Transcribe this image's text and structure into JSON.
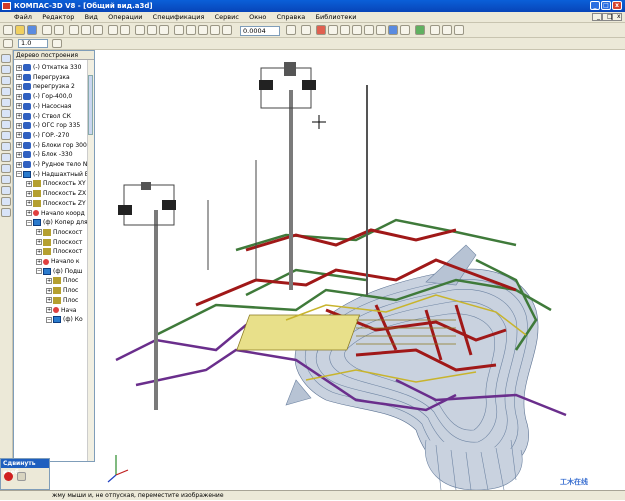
{
  "window": {
    "title": "КОМПАС-3D V8 - [Общий вид.a3d]",
    "controls": [
      "_",
      "□",
      "x"
    ]
  },
  "menu": {
    "items": [
      "Файл",
      "Редактор",
      "Вид",
      "Операции",
      "Спецификация",
      "Сервис",
      "Окно",
      "Справка",
      "Библиотеки"
    ]
  },
  "toolbar": {
    "zoom_value": "0.0004",
    "step_value": "1.0"
  },
  "tree": {
    "header": "Дерево построения",
    "nodes": [
      {
        "label": "(-) Откатка 330",
        "level": 0,
        "icon": "part"
      },
      {
        "label": "Перегрузка",
        "level": 0,
        "icon": "part"
      },
      {
        "label": "перегрузка 2",
        "level": 0,
        "icon": "part"
      },
      {
        "label": "(-) Гор-400,0",
        "level": 0,
        "icon": "part"
      },
      {
        "label": "(-) Насосная",
        "level": 0,
        "icon": "part"
      },
      {
        "label": "(-) Ствол СК",
        "level": 0,
        "icon": "part"
      },
      {
        "label": "(-) ОГС гор 335",
        "level": 0,
        "icon": "part"
      },
      {
        "label": "(-) ГОР.-270",
        "level": 0,
        "icon": "part"
      },
      {
        "label": "(-) Блоки гор 300",
        "level": 0,
        "icon": "part"
      },
      {
        "label": "(-) Блок -330",
        "level": 0,
        "icon": "part"
      },
      {
        "label": "(-) Рудное тело NR2",
        "level": 0,
        "icon": "part"
      },
      {
        "label": "(-) Надшахтный ВС",
        "level": 0,
        "icon": "asm"
      },
      {
        "label": "Плоскость XY",
        "level": 1,
        "icon": "plane"
      },
      {
        "label": "Плоскость ZX",
        "level": 1,
        "icon": "plane"
      },
      {
        "label": "Плоскость ZY",
        "level": 1,
        "icon": "plane"
      },
      {
        "label": "Начало коорд",
        "level": 1,
        "icon": "origin"
      },
      {
        "label": "(ф) Копер для",
        "level": 1,
        "icon": "asm"
      },
      {
        "label": "Плоскост",
        "level": 2,
        "icon": "plane"
      },
      {
        "label": "Плоскост",
        "level": 2,
        "icon": "plane"
      },
      {
        "label": "Плоскост",
        "level": 2,
        "icon": "plane"
      },
      {
        "label": "Начало к",
        "level": 2,
        "icon": "origin"
      },
      {
        "label": "(ф) Подш",
        "level": 2,
        "icon": "asm"
      },
      {
        "label": "Плос",
        "level": 3,
        "icon": "plane"
      },
      {
        "label": "Плос",
        "level": 3,
        "icon": "plane"
      },
      {
        "label": "Плос",
        "level": 3,
        "icon": "plane"
      },
      {
        "label": "Нача",
        "level": 3,
        "icon": "origin"
      },
      {
        "label": "(ф) Ко",
        "level": 3,
        "icon": "asm"
      }
    ]
  },
  "swap_panel": {
    "title": "Сдвинуть изоб"
  },
  "status": {
    "text": "жму мыши и, не отпуская, переместите изображение"
  },
  "watermark": "工木在线",
  "colors": {
    "title_bar": "#0a5fd8",
    "chrome": "#ece9d8",
    "tunnel_red": "#a01818",
    "tunnel_green": "#3f7a3a",
    "tunnel_purple": "#6a2e8c",
    "tunnel_yellow": "#c8b42c",
    "ore_body": "#7e93ad"
  }
}
